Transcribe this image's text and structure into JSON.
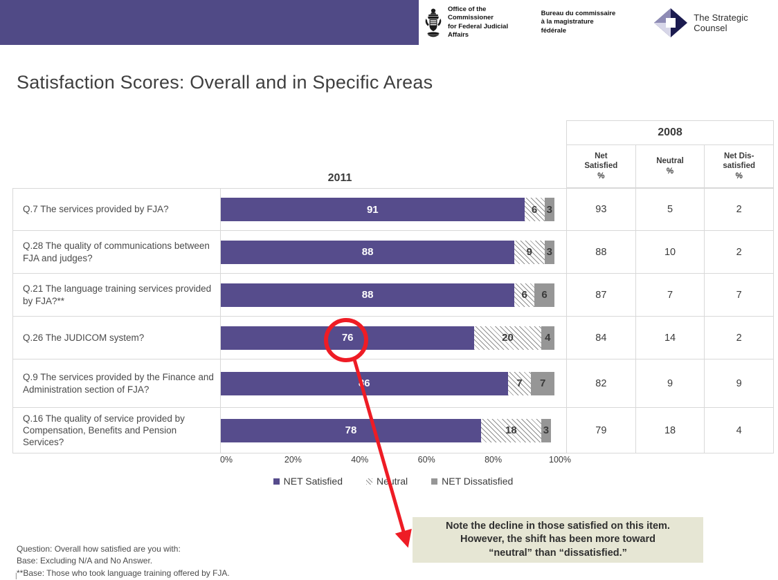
{
  "header": {
    "band_color": "#504A86",
    "fja_en": "Office of the Commissioner\nfor Federal Judicial Affairs",
    "fja_fr": "Bureau du commissaire\nà la magistrature fédérale",
    "tsc_label": "The Strategic Counsel",
    "coat_of_arms_alt": "Canada coat of arms"
  },
  "title": "Satisfaction Scores: Overall and in Specific Areas",
  "table": {
    "year_2011_label": "2011",
    "year_2008_label": "2008",
    "columns_2008": [
      "Net\nSatisfied\n%",
      "Neutral\n%",
      "Net Dis-\nsatisfied\n%"
    ]
  },
  "chart_data": {
    "type": "bar",
    "subtype": "stacked-horizontal-100pct",
    "title": "Satisfaction Scores: Overall and in Specific Areas",
    "xlabel": "",
    "ylabel": "",
    "xlim": [
      0,
      100
    ],
    "xticks": [
      "0%",
      "20%",
      "40%",
      "60%",
      "80%",
      "100%"
    ],
    "xtick_values": [
      0,
      20,
      40,
      60,
      80,
      100
    ],
    "grid": false,
    "legend_position": "bottom-center",
    "legend": [
      "NET Satisfied",
      "Neutral",
      "NET Dissatisfied"
    ],
    "colors": {
      "net_satisfied": "#564C8C",
      "neutral": "#FFFFFF",
      "net_dissatisfied": "#969696"
    },
    "categories": [
      "Q.7 The services provided by FJA?",
      "Q.28 The quality of communications between FJA and judges?",
      "Q.21 The language training services provided by FJA?**",
      "Q.26 The JUDICOM system?",
      "Q.9 The services provided by the Finance and Administration section of FJA?",
      "Q.16 The quality of service provided by Compensation, Benefits and Pension Services?"
    ],
    "series": [
      {
        "name": "NET Satisfied",
        "values": [
          91,
          88,
          88,
          76,
          86,
          78
        ]
      },
      {
        "name": "Neutral",
        "values": [
          6,
          9,
          6,
          20,
          7,
          18
        ]
      },
      {
        "name": "NET Dissatisfied",
        "values": [
          3,
          3,
          6,
          4,
          7,
          3
        ]
      }
    ],
    "comparison_year": "2008",
    "comparison_series": [
      {
        "name": "Net Satisfied %",
        "values": [
          93,
          88,
          87,
          84,
          82,
          79
        ]
      },
      {
        "name": "Neutral %",
        "values": [
          5,
          10,
          7,
          14,
          9,
          18
        ]
      },
      {
        "name": "Net Dissatisfied %",
        "values": [
          2,
          2,
          7,
          2,
          9,
          4
        ]
      }
    ],
    "annotations": [
      {
        "type": "circle-highlight",
        "target": "Q.26 NET Satisfied 76",
        "color": "#EE1C25"
      },
      {
        "type": "arrow",
        "color": "#EE1C25",
        "text": "Note the decline in those satisfied on this item. However, the shift has been more toward “neutral” than “dissatisfied.”"
      }
    ]
  },
  "rows": [
    {
      "label": "Q.7 The services provided by FJA?",
      "sat": 91,
      "neu": 6,
      "dis": 3,
      "sat_label": "91",
      "neu_label": "6",
      "dis_label": "3",
      "y2008_sat": "93",
      "y2008_neu": "5",
      "y2008_dis": "2"
    },
    {
      "label": "Q.28 The quality of communications between FJA and judges?",
      "sat": 88,
      "neu": 9,
      "dis": 3,
      "sat_label": "88",
      "neu_label": "9",
      "dis_label": "3",
      "y2008_sat": "88",
      "y2008_neu": "10",
      "y2008_dis": "2"
    },
    {
      "label": "Q.21 The language training services provided by FJA?**",
      "sat": 88,
      "neu": 6,
      "dis": 6,
      "sat_label": "88",
      "neu_label": "6",
      "dis_label": "6",
      "y2008_sat": "87",
      "y2008_neu": "7",
      "y2008_dis": "7"
    },
    {
      "label": "Q.26 The JUDICOM system?",
      "sat": 76,
      "neu": 20,
      "dis": 4,
      "sat_label": "76",
      "neu_label": "20",
      "dis_label": "4",
      "y2008_sat": "84",
      "y2008_neu": "14",
      "y2008_dis": "2"
    },
    {
      "label": "Q.9 The services provided by the Finance and Administration section of FJA?",
      "sat": 86,
      "neu": 7,
      "dis": 7,
      "sat_label": "86",
      "neu_label": "7",
      "dis_label": "7",
      "y2008_sat": "82",
      "y2008_neu": "9",
      "y2008_dis": "9"
    },
    {
      "label": "Q.16 The quality of service provided by Compensation, Benefits and Pension Services?",
      "sat": 78,
      "neu": 18,
      "dis": 3,
      "sat_label": "78",
      "neu_label": "18",
      "dis_label": "3",
      "y2008_sat": "79",
      "y2008_neu": "18",
      "y2008_dis": "4"
    }
  ],
  "axis": {
    "ticks": [
      "0%",
      "20%",
      "40%",
      "60%",
      "80%",
      "100%"
    ]
  },
  "legend": {
    "items": [
      "NET Satisfied",
      "Neutral",
      "NET Dissatisfied"
    ]
  },
  "callout": {
    "text": "Note the decline in those satisfied on this item.\nHowever, the shift has been more toward\n“neutral” than “dissatisfied.”",
    "bg": "#E6E6D4"
  },
  "footnotes": {
    "line1": "Question: Overall how satisfied are you with:",
    "line2": "Base: Excluding N/A and No Answer.",
    "line3": "**Base: Those who took language training offered by FJA."
  }
}
